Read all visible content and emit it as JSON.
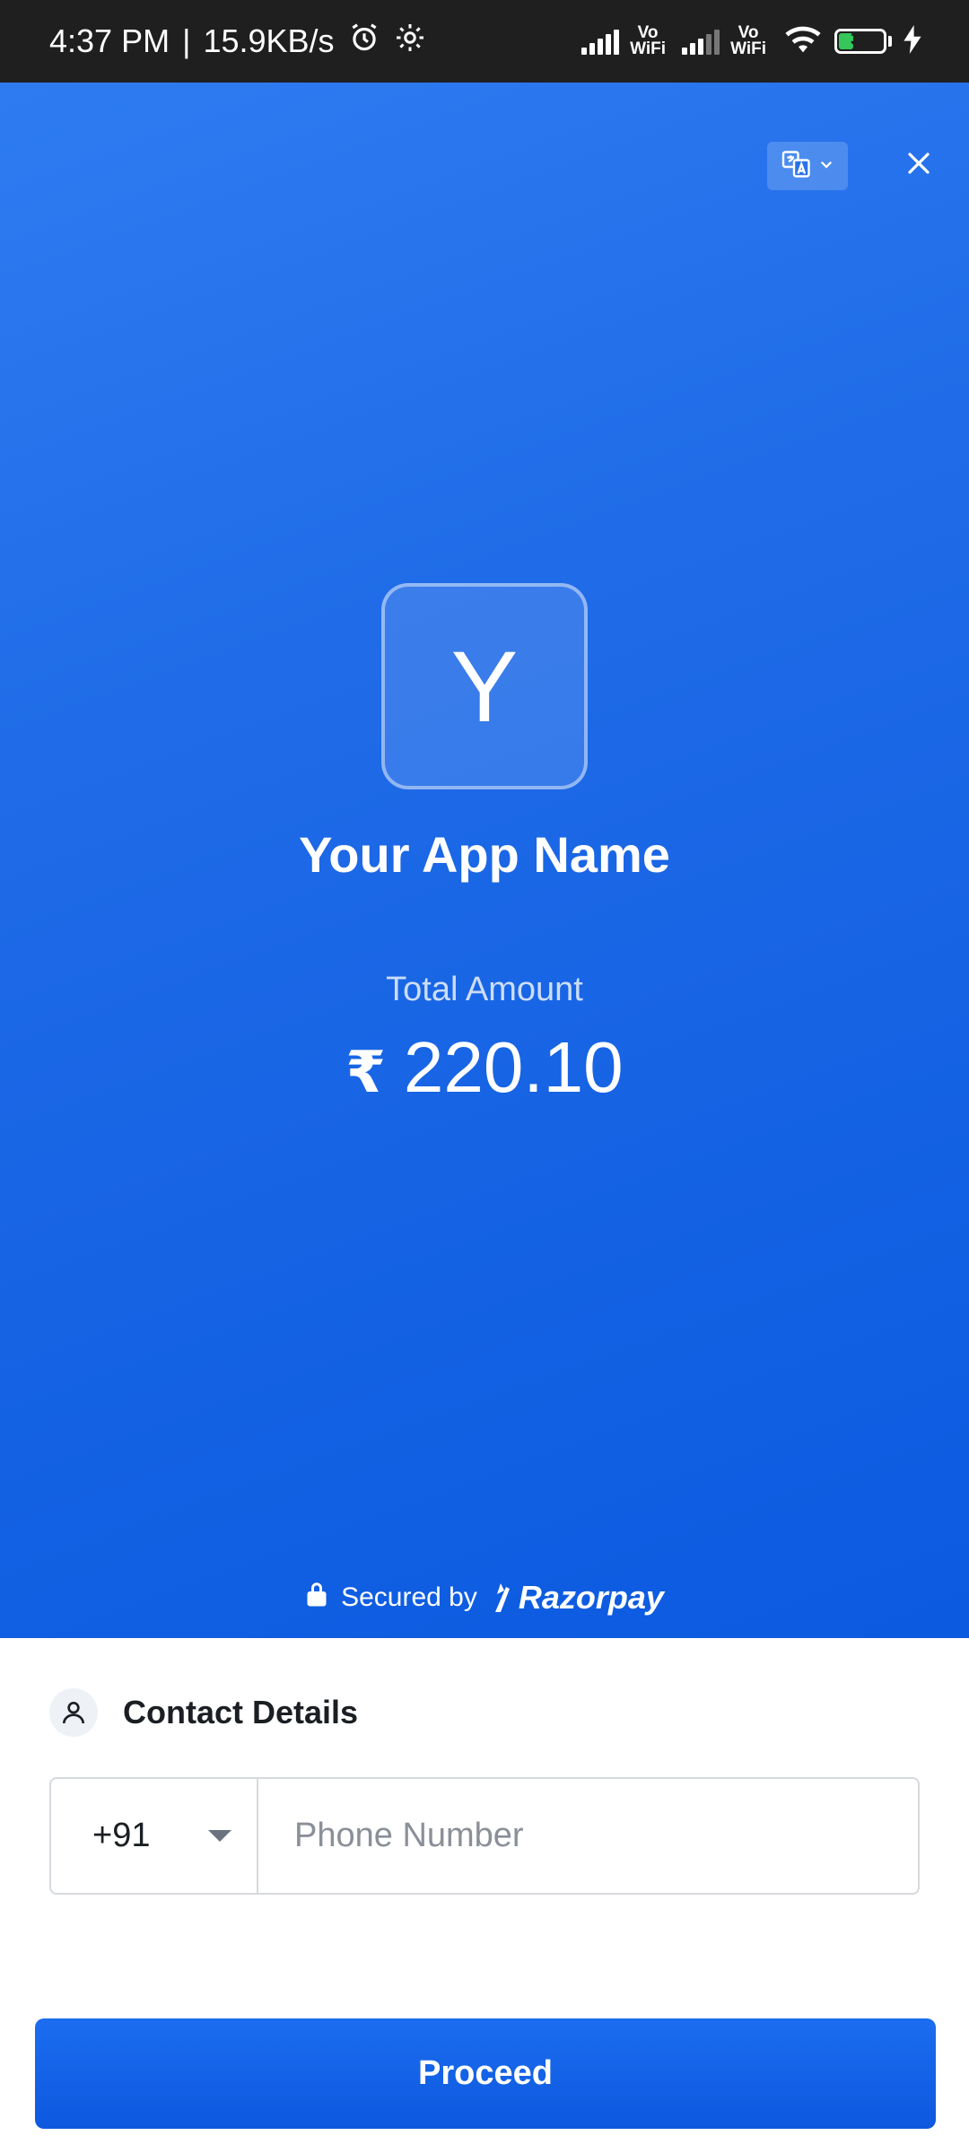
{
  "status_bar": {
    "time": "4:37 PM",
    "separator": "|",
    "speed": "15.9KB/s",
    "vowifi_top": "Vo",
    "vowifi_bottom": "WiFi",
    "battery": "31"
  },
  "header": {
    "language_icon": "translate-icon",
    "close_icon": "close-icon"
  },
  "merchant": {
    "logo_letter": "Y",
    "name": "Your App Name"
  },
  "payment": {
    "label": "Total Amount",
    "currency_symbol": "₹",
    "amount": "220.10"
  },
  "footer_badge": {
    "secured_by": "Secured by",
    "brand": "Razorpay"
  },
  "contact": {
    "title": "Contact Details",
    "country_code": "+91",
    "phone_placeholder": "Phone Number"
  },
  "actions": {
    "proceed": "Proceed"
  },
  "colors": {
    "brand_blue": "#1e6ae7",
    "button_blue": "#0d58de"
  }
}
